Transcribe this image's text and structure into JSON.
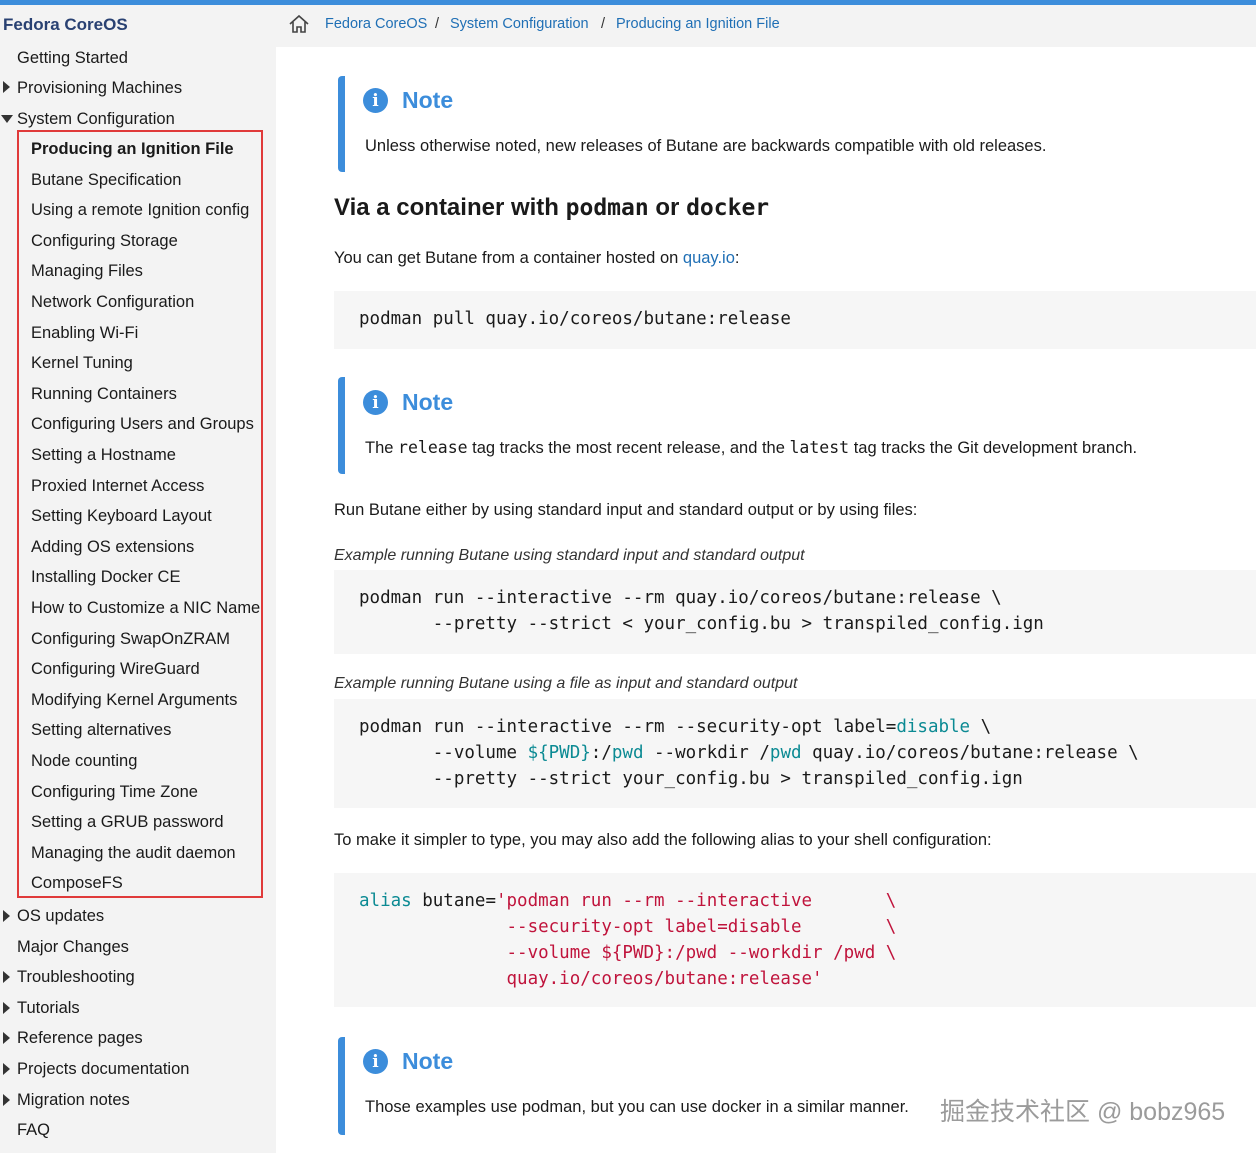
{
  "brand": "Fedora CoreOS",
  "breadcrumb": [
    "Fedora CoreOS",
    "System Configuration",
    "Producing an Ignition File"
  ],
  "sidebar": {
    "top_items": [
      {
        "label": "Getting Started",
        "expandable": false
      },
      {
        "label": "Provisioning Machines",
        "expandable": true
      },
      {
        "label": "System Configuration",
        "expandable": true,
        "expanded": true
      }
    ],
    "sub_items": [
      "Producing an Ignition File",
      "Butane Specification",
      "Using a remote Ignition config",
      "Configuring Storage",
      "Managing Files",
      "Network Configuration",
      "Enabling Wi-Fi",
      "Kernel Tuning",
      "Running Containers",
      "Configuring Users and Groups",
      "Setting a Hostname",
      "Proxied Internet Access",
      "Setting Keyboard Layout",
      "Adding OS extensions",
      "Installing Docker CE",
      "How to Customize a NIC Name",
      "Configuring SwapOnZRAM",
      "Configuring WireGuard",
      "Modifying Kernel Arguments",
      "Setting alternatives",
      "Node counting",
      "Configuring Time Zone",
      "Setting a GRUB password",
      "Managing the audit daemon",
      "ComposeFS"
    ],
    "bottom_items": [
      {
        "label": "OS updates",
        "expandable": true
      },
      {
        "label": "Major Changes",
        "expandable": false
      },
      {
        "label": "Troubleshooting",
        "expandable": true
      },
      {
        "label": "Tutorials",
        "expandable": true
      },
      {
        "label": "Reference pages",
        "expandable": true
      },
      {
        "label": "Projects documentation",
        "expandable": true
      },
      {
        "label": "Migration notes",
        "expandable": true
      },
      {
        "label": "FAQ",
        "expandable": false
      }
    ]
  },
  "content": {
    "note1": {
      "title": "Note",
      "text": "Unless otherwise noted, new releases of Butane are backwards compatible with old releases."
    },
    "heading": "Via a container with podman or docker",
    "heading_plain": "Via a container with ",
    "heading_code1": "podman",
    "heading_or": " or ",
    "heading_code2": "docker",
    "intro_text": "You can get Butane from a container hosted on ",
    "intro_link": "quay.io",
    "intro_end": ":",
    "code1": "podman pull quay.io/coreos/butane:release",
    "note2": {
      "title": "Note",
      "t1": "The ",
      "c1": "release",
      "t2": " tag tracks the most recent release, and the ",
      "c2": "latest",
      "t3": " tag tracks the Git development branch."
    },
    "run_text": "Run Butane either by using standard input and standard output or by using files:",
    "caption1": "Example running Butane using standard input and standard output",
    "code2": [
      "podman run --interactive --rm quay.io/coreos/butane:release \\",
      "       --pretty --strict < your_config.bu > transpiled_config.ign"
    ],
    "caption2": "Example running Butane using a file as input and standard output",
    "code3": {
      "l1a": "podman run --interactive --rm --security-opt label=",
      "l1b": "disable",
      "l1c": " \\",
      "l2a": "       --volume ",
      "l2b": "${PWD}",
      "l2c": ":/",
      "l2d": "pwd",
      "l2e": " --workdir /",
      "l2f": "pwd",
      "l2g": " quay.io/coreos/butane:release \\",
      "l3": "       --pretty --strict your_config.bu > transpiled_config.ign"
    },
    "alias_text": "To make it simpler to type, you may also add the following alias to your shell configuration:",
    "code4": {
      "kw": "alias",
      "l1a": " butane=",
      "l1b": "'podman run --rm --interactive       \\",
      "l2": "              --security-opt label=disable        \\",
      "l3": "              --volume ${PWD}:/pwd --workdir /pwd \\",
      "l4": "              quay.io/coreos/butane:release'"
    },
    "note3": {
      "title": "Note",
      "text": "Those examples use podman, but you can use docker in a similar manner."
    }
  },
  "watermark": "掘金技术社区 @ bobz965",
  "colors": {
    "accent": "#3c8ddb",
    "link": "#1f6fb5",
    "highlight_border": "#e03a3a",
    "code_var": "#0b8a93",
    "code_string": "#c0143c"
  }
}
